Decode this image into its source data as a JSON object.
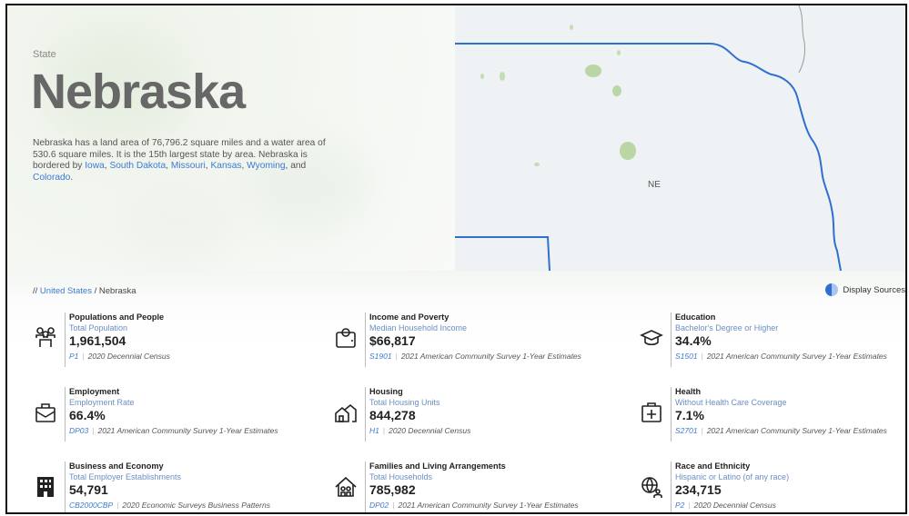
{
  "hero": {
    "tag": "State",
    "title": "Nebraska",
    "desc_text": "Nebraska has a land area of 76,796.2 square miles and a water area of 530.6 square miles. It is the 15th largest state by area. Nebraska is bordered by",
    "neighbors": [
      "Iowa",
      "South Dakota",
      "Missouri",
      "Kansas",
      "Wyoming",
      "Colorado"
    ],
    "sep_comma": ",",
    "sep_and": ", and",
    "period": ".",
    "map_label": "NE"
  },
  "breadcrumb": {
    "root_prefix": "//",
    "root": "United States",
    "sep": "/",
    "current": "Nebraska"
  },
  "toggle": {
    "label": "Display Sources"
  },
  "cards": [
    {
      "title": "Populations and People",
      "metric": "Total Population",
      "value": "1,961,504",
      "code": "P1",
      "source": "2020 Decennial Census"
    },
    {
      "title": "Income and Poverty",
      "metric": "Median Household Income",
      "value": "$66,817",
      "code": "S1901",
      "source": "2021 American Community Survey 1-Year Estimates"
    },
    {
      "title": "Education",
      "metric": "Bachelor's Degree or Higher",
      "value": "34.4%",
      "code": "S1501",
      "source": "2021 American Community Survey 1-Year Estimates"
    },
    {
      "title": "Employment",
      "metric": "Employment Rate",
      "value": "66.4%",
      "code": "DP03",
      "source": "2021 American Community Survey 1-Year Estimates"
    },
    {
      "title": "Housing",
      "metric": "Total Housing Units",
      "value": "844,278",
      "code": "H1",
      "source": "2020 Decennial Census"
    },
    {
      "title": "Health",
      "metric": "Without Health Care Coverage",
      "value": "7.1%",
      "code": "S2701",
      "source": "2021 American Community Survey 1-Year Estimates"
    },
    {
      "title": "Business and Economy",
      "metric": "Total Employer Establishments",
      "value": "54,791",
      "code": "CB2000CBP",
      "source": "2020 Economic Surveys Business Patterns"
    },
    {
      "title": "Families and Living Arrangements",
      "metric": "Total Households",
      "value": "785,982",
      "code": "DP02",
      "source": "2021 American Community Survey 1-Year Estimates"
    },
    {
      "title": "Race and Ethnicity",
      "metric": "Hispanic or Latino (of any race)",
      "value": "234,715",
      "code": "P2",
      "source": "2020 Decennial Census"
    }
  ],
  "icons": [
    "people-icon",
    "wallet-icon",
    "graduation-cap-icon",
    "briefcase-icon",
    "houses-icon",
    "medical-kit-icon",
    "office-building-icon",
    "family-home-icon",
    "globe-people-icon"
  ],
  "colors": {
    "link": "#3b7bd2",
    "title_gray": "#676767",
    "map_border": "#2f6fd0"
  }
}
